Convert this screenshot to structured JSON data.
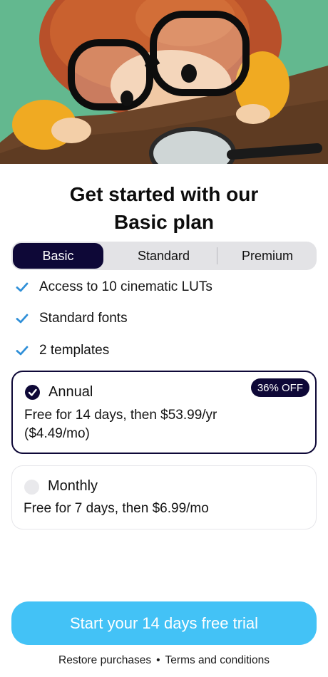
{
  "colors": {
    "accent": "#0e0837",
    "cta": "#43c2f6",
    "check": "#2f8fd8",
    "hero_bg": "#5fb48a",
    "table": "#6b4428"
  },
  "hero": {
    "icon": "illustration-child-with-glasses-and-magnifier"
  },
  "title": {
    "line1": "Get started with our",
    "line2": "Basic plan"
  },
  "tabs": [
    {
      "label": "Basic",
      "selected": true
    },
    {
      "label": "Standard",
      "selected": false
    },
    {
      "label": "Premium",
      "selected": false
    }
  ],
  "features": [
    {
      "icon": "checkmark-icon",
      "label": "Access to 10 cinematic LUTs"
    },
    {
      "icon": "checkmark-icon",
      "label": "Standard fonts"
    },
    {
      "icon": "checkmark-icon",
      "label": "2 templates"
    }
  ],
  "plans": {
    "annual": {
      "name": "Annual",
      "badge": "36% OFF",
      "line1": "Free for 14 days, then $53.99/yr",
      "line2": "($4.49/mo)",
      "selected": true
    },
    "monthly": {
      "name": "Monthly",
      "line1": "Free for 7 days, then $6.99/mo",
      "selected": false
    }
  },
  "cta": {
    "label": "Start your 14 days free trial"
  },
  "footer": {
    "restore": "Restore purchases",
    "separator": "•",
    "terms": "Terms and conditions"
  }
}
